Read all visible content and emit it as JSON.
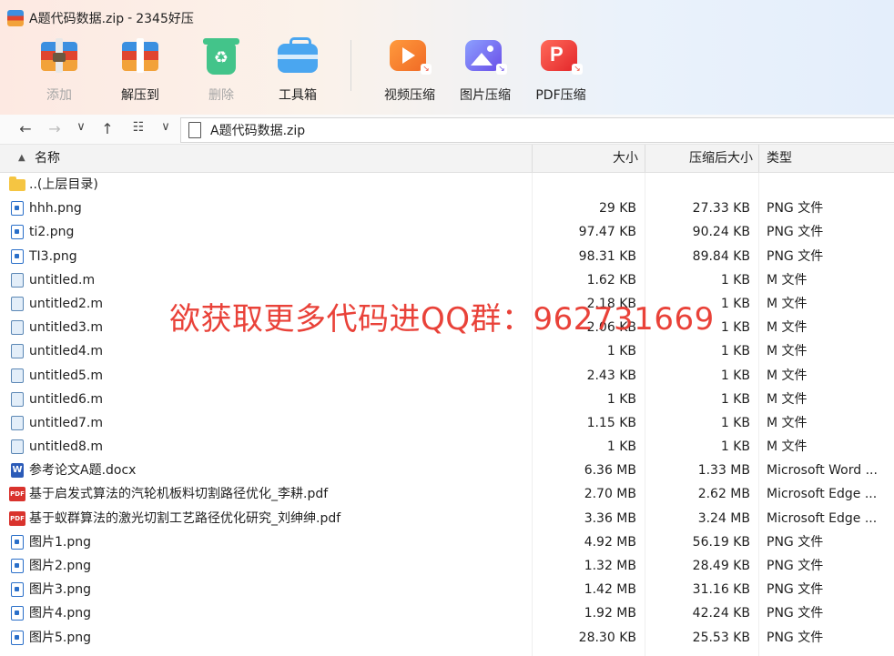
{
  "window": {
    "title": "A题代码数据.zip",
    "separator": "-",
    "app_name": "2345好压"
  },
  "toolbar": {
    "add": "添加",
    "extract": "解压到",
    "delete": "删除",
    "tools": "工具箱",
    "video": "视频压缩",
    "image": "图片压缩",
    "pdf": "PDF压缩"
  },
  "address": {
    "path": "A题代码数据.zip"
  },
  "columns": {
    "name": "名称",
    "size": "大小",
    "compressed": "压缩后大小",
    "type": "类型"
  },
  "rows": [
    {
      "name": "..(上层目录)",
      "size": "",
      "compressed": "",
      "type": "",
      "icon": "folder"
    },
    {
      "name": "hhh.png",
      "size": "29 KB",
      "compressed": "27.33 KB",
      "type": "PNG 文件",
      "icon": "png"
    },
    {
      "name": "ti2.png",
      "size": "97.47 KB",
      "compressed": "90.24 KB",
      "type": "PNG 文件",
      "icon": "png"
    },
    {
      "name": "TI3.png",
      "size": "98.31 KB",
      "compressed": "89.84 KB",
      "type": "PNG 文件",
      "icon": "png"
    },
    {
      "name": "untitled.m",
      "size": "1.62 KB",
      "compressed": "1 KB",
      "type": "M 文件",
      "icon": "m"
    },
    {
      "name": "untitled2.m",
      "size": "2.18 KB",
      "compressed": "1 KB",
      "type": "M 文件",
      "icon": "m"
    },
    {
      "name": "untitled3.m",
      "size": "2.06 KB",
      "compressed": "1 KB",
      "type": "M 文件",
      "icon": "m"
    },
    {
      "name": "untitled4.m",
      "size": "1 KB",
      "compressed": "1 KB",
      "type": "M 文件",
      "icon": "m"
    },
    {
      "name": "untitled5.m",
      "size": "2.43 KB",
      "compressed": "1 KB",
      "type": "M 文件",
      "icon": "m"
    },
    {
      "name": "untitled6.m",
      "size": "1 KB",
      "compressed": "1 KB",
      "type": "M 文件",
      "icon": "m"
    },
    {
      "name": "untitled7.m",
      "size": "1.15 KB",
      "compressed": "1 KB",
      "type": "M 文件",
      "icon": "m"
    },
    {
      "name": "untitled8.m",
      "size": "1 KB",
      "compressed": "1 KB",
      "type": "M 文件",
      "icon": "m"
    },
    {
      "name": "参考论文A题.docx",
      "size": "6.36 MB",
      "compressed": "1.33 MB",
      "type": "Microsoft Word ...",
      "icon": "doc"
    },
    {
      "name": "基于启发式算法的汽轮机板料切割路径优化_李耕.pdf",
      "size": "2.70 MB",
      "compressed": "2.62 MB",
      "type": "Microsoft Edge ...",
      "icon": "pdf"
    },
    {
      "name": "基于蚁群算法的激光切割工艺路径优化研究_刘绅绅.pdf",
      "size": "3.36 MB",
      "compressed": "3.24 MB",
      "type": "Microsoft Edge ...",
      "icon": "pdf"
    },
    {
      "name": "图片1.png",
      "size": "4.92 MB",
      "compressed": "56.19 KB",
      "type": "PNG 文件",
      "icon": "png"
    },
    {
      "name": "图片2.png",
      "size": "1.32 MB",
      "compressed": "28.49 KB",
      "type": "PNG 文件",
      "icon": "png"
    },
    {
      "name": "图片3.png",
      "size": "1.42 MB",
      "compressed": "31.16 KB",
      "type": "PNG 文件",
      "icon": "png"
    },
    {
      "name": "图片4.png",
      "size": "1.92 MB",
      "compressed": "42.24 KB",
      "type": "PNG 文件",
      "icon": "png"
    },
    {
      "name": "图片5.png",
      "size": "28.30 KB",
      "compressed": "25.53 KB",
      "type": "PNG 文件",
      "icon": "png"
    }
  ],
  "watermark": "欲获取更多代码进QQ群：962731669"
}
